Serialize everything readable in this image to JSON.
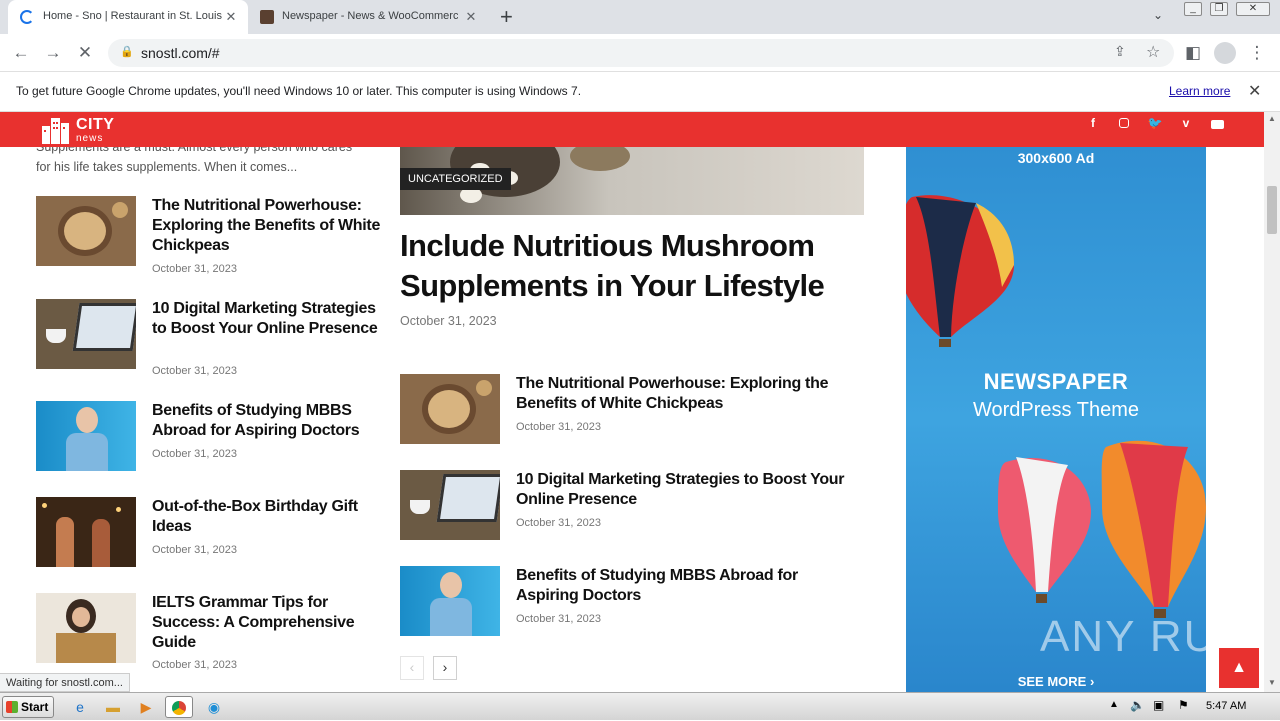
{
  "browser": {
    "tabs": [
      {
        "title": "Home - Sno | Restaurant in St. Louis",
        "active": true
      },
      {
        "title": "Newspaper - News & WooCommerce",
        "active": false
      }
    ],
    "url": "snostl.com/#",
    "new_tab_symbol": "+",
    "info_bar": {
      "text": "To get future Google Chrome updates, you'll need Windows 10 or later. This computer is using Windows 7.",
      "link": "Learn more"
    },
    "status_text": "Waiting for snostl.com..."
  },
  "site": {
    "logo_top": "CITY",
    "logo_bottom": "news",
    "social_icons": [
      "facebook-icon",
      "instagram-icon",
      "twitter-icon",
      "vimeo-icon",
      "youtube-icon"
    ],
    "accent_color": "#e8312f"
  },
  "left_column": {
    "intro_excerpt": "Supplements are a must. Almost every person who cares for his life takes supplements. When it comes...",
    "articles": [
      {
        "title": "The Nutritional Powerhouse: Exploring the Benefits of White Chickpeas",
        "date": "October 31, 2023"
      },
      {
        "title": "10 Digital Marketing Strategies to Boost Your Online Presence",
        "date": "October 31, 2023"
      },
      {
        "title": "Benefits of Studying MBBS Abroad for Aspiring Doctors",
        "date": "October 31, 2023"
      },
      {
        "title": "Out-of-the-Box Birthday Gift Ideas",
        "date": "October 31, 2023"
      },
      {
        "title": "IELTS Grammar Tips for Success: A Comprehensive Guide",
        "date": "October 31, 2023"
      }
    ]
  },
  "main_column": {
    "category_badge": "UNCATEGORIZED",
    "featured_title": "Include Nutritious Mushroom Supplements in Your Lifestyle",
    "featured_date": "October 31, 2023",
    "articles": [
      {
        "title": "The Nutritional Powerhouse: Exploring the Benefits of White Chickpeas",
        "date": "October 31, 2023"
      },
      {
        "title": "10 Digital Marketing Strategies to Boost Your Online Presence",
        "date": "October 31, 2023"
      },
      {
        "title": "Benefits of Studying MBBS Abroad for Aspiring Doctors",
        "date": "October 31, 2023"
      }
    ],
    "prev_symbol": "‹",
    "next_symbol": "›"
  },
  "ad": {
    "size_label": "300x600 Ad",
    "brand": "NEWSPAPER",
    "subtitle": "WordPress Theme",
    "cta": "SEE MORE ›"
  },
  "watermark": "ANY RUN",
  "back_to_top_symbol": "▲",
  "taskbar": {
    "start_label": "Start",
    "clock": "5:47 AM"
  }
}
